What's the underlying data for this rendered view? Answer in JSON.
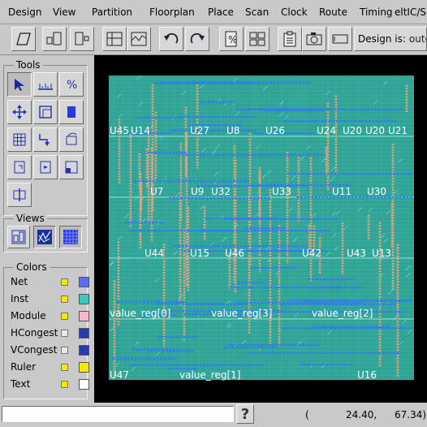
{
  "menubar": {
    "items": [
      {
        "label": "Design"
      },
      {
        "label": "View"
      },
      {
        "label": "Partition"
      },
      {
        "label": "Floorplan"
      },
      {
        "label": "Place"
      },
      {
        "label": "Scan"
      },
      {
        "label": "Clock"
      },
      {
        "label": "Route"
      },
      {
        "label": "Timing"
      },
      {
        "label": "eltIC/S"
      }
    ]
  },
  "toolbar": {
    "icons": [
      "parallelogram-icon",
      "cell-pair-icon",
      "cell-pin-icon",
      "floorplan-grid-icon",
      "floorplan-chart-icon",
      "undo-icon",
      "redo-icon",
      "zoom-icon",
      "tile-layout-icon",
      "clipboard-icon",
      "camera-icon",
      "window-icon"
    ],
    "design_label": "Design is:",
    "design_value": "oute"
  },
  "tools": {
    "title": "Tools",
    "icons": [
      "select-arrow-icon",
      "ruler-icon",
      "zoom-icon",
      "move-icon",
      "resize-icon",
      "fill-rect-icon",
      "grid-icon",
      "route-icon",
      "rotate-icon",
      "place-icon",
      "place-right-icon",
      "corner-icon",
      "center-icon"
    ]
  },
  "views": {
    "title": "Views",
    "icons": [
      "layout-view-icon",
      "flylines-view-icon",
      "congestion-view-icon"
    ]
  },
  "colors": {
    "title": "Colors",
    "rows": [
      {
        "label": "Net",
        "checkbox": "#f4e800",
        "swatch": "#5a6cf0"
      },
      {
        "label": "Inst",
        "checkbox": "#f4e800",
        "swatch": "#40c8c0"
      },
      {
        "label": "Module",
        "checkbox": "#f4e800",
        "swatch": "#f4b8d0"
      },
      {
        "label": "HCongest",
        "checkbox": "#e8e8e8",
        "swatch": "#2a3aa8"
      },
      {
        "label": "VCongest",
        "checkbox": "#e8e8e8",
        "swatch": "#2a3aa8"
      },
      {
        "label": "Ruler",
        "checkbox": "#f4e800",
        "swatch": "#f4e800"
      },
      {
        "label": "Text",
        "checkbox": "#f4e800",
        "swatch": "#ffffff"
      }
    ]
  },
  "layout": {
    "background": "#2fa396",
    "cell_labels": [
      {
        "text": "U45"
      },
      {
        "text": "U14"
      },
      {
        "text": "U27"
      },
      {
        "text": "U8"
      },
      {
        "text": "U26"
      },
      {
        "text": "U24"
      },
      {
        "text": "U20"
      },
      {
        "text": "U20"
      },
      {
        "text": "U21"
      },
      {
        "text": "U7"
      },
      {
        "text": "U9"
      },
      {
        "text": "U32"
      },
      {
        "text": "U33"
      },
      {
        "text": "U11"
      },
      {
        "text": "U30"
      },
      {
        "text": "U44"
      },
      {
        "text": "U15"
      },
      {
        "text": "U46"
      },
      {
        "text": "U42"
      },
      {
        "text": "U43"
      },
      {
        "text": "U13"
      },
      {
        "text": "value_reg[0]"
      },
      {
        "text": "value_reg[3]"
      },
      {
        "text": "value_reg[2]"
      },
      {
        "text": "U47"
      },
      {
        "text": "value_reg[1]"
      },
      {
        "text": "U16"
      }
    ]
  },
  "status": {
    "input_value": "",
    "help": "?",
    "open_paren": "(",
    "x": "24.40,",
    "y": "67.34)"
  }
}
